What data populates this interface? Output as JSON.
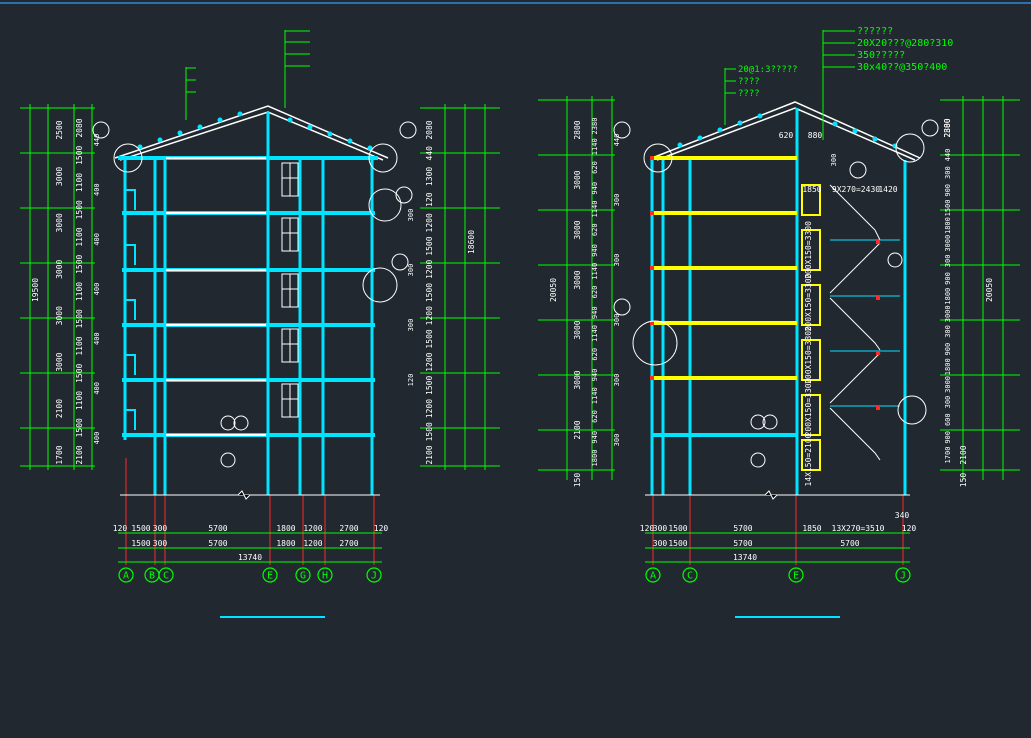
{
  "colors": {
    "background": "#212830",
    "structure": "#00e5ff",
    "dimension": "#00ff00",
    "axis_line": "#ff2a2a",
    "stair_slab": "#ffff00",
    "outline": "#ffffff",
    "text": "#ffffff",
    "dim_text": "#ffffff",
    "underline": "#00e5ff"
  },
  "left": {
    "left_dims_outer": [
      "2500",
      "3000",
      "3000",
      "3000",
      "3000",
      "3000",
      "2100",
      "1700"
    ],
    "left_dims_inner": [
      "2080",
      "1500",
      "1100",
      "1500",
      "1100",
      "1500",
      "1100",
      "1500",
      "1100",
      "1500",
      "1100",
      "1500",
      "2100"
    ],
    "left_dims_small": [
      "440",
      "400",
      "400",
      "400",
      "400",
      "400",
      "400"
    ],
    "total_height_left": "19500",
    "right_dims": [
      "2080",
      "440",
      "1300",
      "120",
      "1200",
      "1500",
      "1200",
      "1500",
      "1200",
      "1500",
      "1200",
      "1500",
      "1200",
      "1500",
      "2100",
      "300",
      "300",
      "300",
      "120"
    ],
    "right_total": "18600",
    "bottom_dims_row1": [
      "120",
      "1500",
      "300",
      "5700",
      "1800",
      "1200",
      "2700",
      "120"
    ],
    "bottom_dims_row2": [
      "1500",
      "300",
      "5700",
      "1800",
      "1200",
      "2700"
    ],
    "total_width": "13740",
    "axes": [
      "A",
      "B",
      "C",
      "E",
      "G",
      "H",
      "J"
    ]
  },
  "right": {
    "notes_top": [
      "??????",
      "20X20???@280?310",
      "350?????",
      "30x40??@350?400"
    ],
    "notes_left": [
      "20@1:3?????",
      "????",
      "????"
    ],
    "left_dims_outer": [
      "2800",
      "3000",
      "3000",
      "3000",
      "3000",
      "3000",
      "2100",
      "150"
    ],
    "left_dims_inner": [
      "2380",
      "1140",
      "620",
      "940",
      "1140",
      "620",
      "940",
      "1140",
      "620",
      "940",
      "1140",
      "620",
      "940",
      "1140",
      "620",
      "940",
      "1800"
    ],
    "left_dims_small": [
      "440",
      "300",
      "300",
      "300",
      "300",
      "300"
    ],
    "total_height_left": "20050",
    "right_dims": [
      "2380",
      "2800",
      "440",
      "300",
      "900",
      "1500",
      "1800",
      "3000",
      "300",
      "900",
      "1800",
      "3000",
      "300",
      "900",
      "1800",
      "3000",
      "300",
      "600",
      "900",
      "1700",
      "2100",
      "150"
    ],
    "right_total": "20050",
    "stair_labels": [
      "1850",
      "9X270=2430",
      "1420",
      "200X150=3300",
      "200X150=3300",
      "200X150=3300",
      "200X150=3300",
      "14X150=2100",
      "620",
      "880",
      "300"
    ],
    "bottom_dims_row1": [
      "120",
      "300",
      "1500",
      "5700",
      "1850",
      "13X270=3510",
      "340",
      "120"
    ],
    "bottom_dims_row2": [
      "300",
      "1500",
      "5700",
      "5700"
    ],
    "total_width": "13740",
    "axes": [
      "A",
      "C",
      "E",
      "J"
    ]
  }
}
